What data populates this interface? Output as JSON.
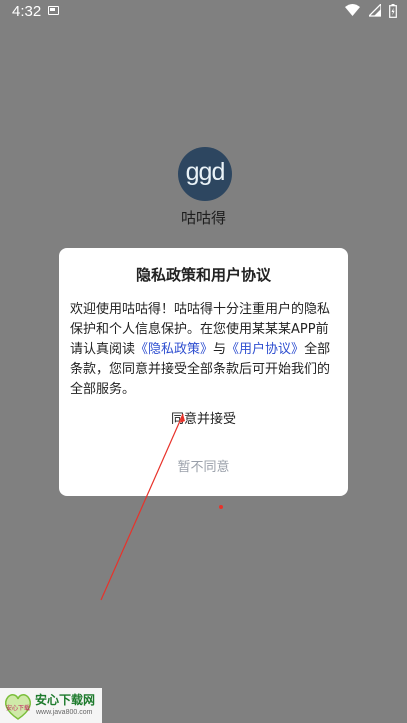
{
  "status_bar": {
    "time": "4:32"
  },
  "app": {
    "logo_text": "ggd",
    "name": "咕咕得"
  },
  "dialog": {
    "title": "隐私政策和用户协议",
    "body_intro": "欢迎使用咕咕得！咕咕得十分注重用户的隐私保护和个人信息保护。在您使用某某某APP前请认真阅读",
    "privacy_link": "《隐私政策》",
    "body_and": "与",
    "user_agreement_link": "《用户协议》",
    "body_outro": "全部条款，您同意并接受全部条款后可开始我们的全部服务。",
    "accept_label": "同意并接受",
    "decline_label": "暂不同意"
  },
  "watermark": {
    "title": "安心下载网",
    "url": "www.java800.com",
    "logo_text": "安心下载"
  },
  "colors": {
    "overlay": "#808080",
    "link": "#2f4fd0",
    "decline": "#9aa0aa",
    "annotation": "#e8322a"
  }
}
